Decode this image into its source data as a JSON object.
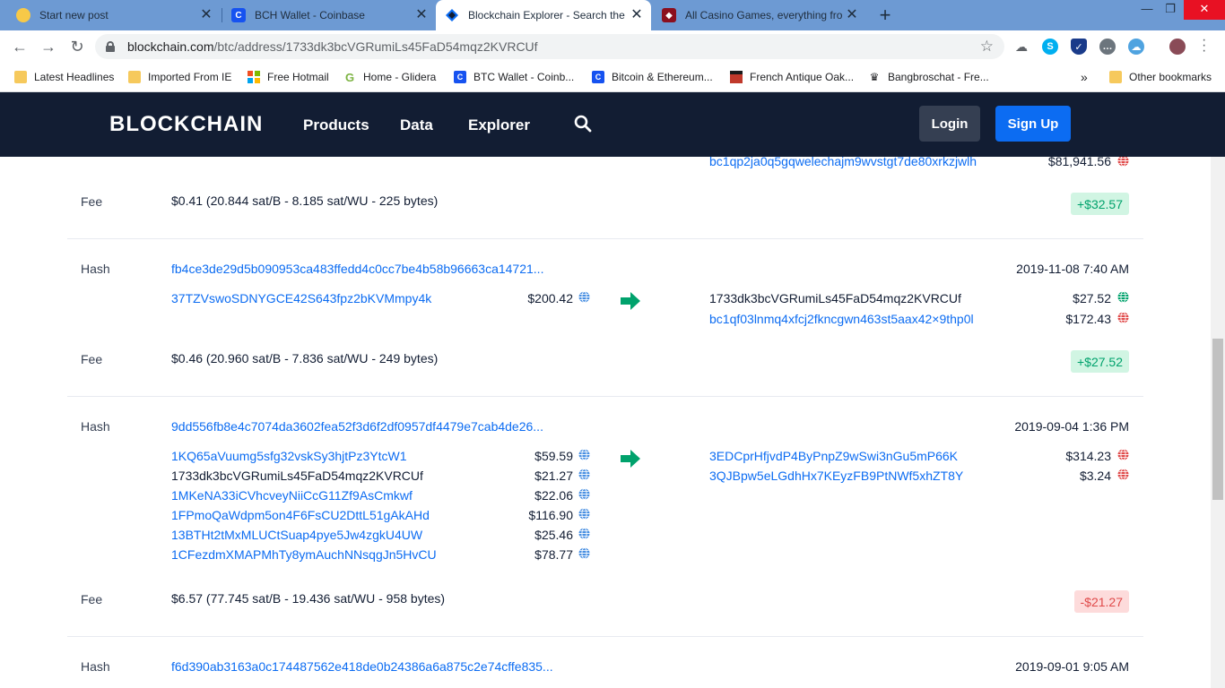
{
  "browser": {
    "tabs": [
      {
        "title": "Start new post"
      },
      {
        "title": "BCH Wallet - Coinbase"
      },
      {
        "title": "Blockchain Explorer - Search the"
      },
      {
        "title": "All Casino Games, everything fro"
      }
    ],
    "url_host": "blockchain.com",
    "url_path": "/btc/address/1733dk3bcVGRumiLs45FaD54mqz2KVRCUf",
    "bookmarks": [
      "Latest Headlines",
      "Imported From IE",
      "Free Hotmail",
      "Home - Glidera",
      "BTC Wallet - Coinb...",
      "Bitcoin & Ethereum...",
      "French Antique Oak...",
      "Bangbroschat - Fre..."
    ],
    "other_bookmarks": "Other bookmarks",
    "overflow": "»"
  },
  "site": {
    "logo": "BLOCKCHAIN",
    "nav": [
      "Products",
      "Data",
      "Explorer"
    ],
    "login": "Login",
    "signup": "Sign Up"
  },
  "labels": {
    "hash": "Hash",
    "fee": "Fee"
  },
  "transactions": [
    {
      "outputs": [
        {
          "address": "bc1qp2ja0q5gqwelechajm9wvstgt7de80xrkzjwlh",
          "amount": "$81,941.56"
        }
      ],
      "fee": "$0.41  (20.844 sat/B - 8.185 sat/WU - 225 bytes)",
      "delta": "+$32.57"
    },
    {
      "hash": "fb4ce3de29d5b090953ca483ffedd4c0cc7be4b58b96663ca14721...",
      "date": "2019-11-08 7:40 AM",
      "inputs": [
        {
          "address": "37TZVswoSDNYGCE42S643fpz2bKVMmpy4k",
          "amount": "$200.42"
        }
      ],
      "outputs": [
        {
          "address": "1733dk3bcVGRumiLs45FaD54mqz2KVRCUf",
          "amount": "$27.52"
        },
        {
          "address": "bc1qf03lnmq4xfcj2fkncgwn463st5aax42×9thp0l",
          "amount": "$172.43"
        }
      ],
      "fee": "$0.46  (20.960 sat/B - 7.836 sat/WU - 249 bytes)",
      "delta": "+$27.52"
    },
    {
      "hash": "9dd556fb8e4c7074da3602fea52f3d6f2df0957df4479e7cab4de26...",
      "date": "2019-09-04 1:36 PM",
      "inputs": [
        {
          "address": "1KQ65aVuumg5sfg32vskSy3hjtPz3YtcW1",
          "amount": "$59.59"
        },
        {
          "address": "1733dk3bcVGRumiLs45FaD54mqz2KVRCUf",
          "amount": "$21.27"
        },
        {
          "address": "1MKeNA33iCVhcveyNiiCcG11Zf9AsCmkwf",
          "amount": "$22.06"
        },
        {
          "address": "1FPmoQaWdpm5on4F6FsCU2DttL51gAkAHd",
          "amount": "$116.90"
        },
        {
          "address": "13BTHt2tMxMLUCtSuap4pye5Jw4zgkU4UW",
          "amount": "$25.46"
        },
        {
          "address": "1CFezdmXMAPMhTy8ymAuchNNsqgJn5HvCU",
          "amount": "$78.77"
        }
      ],
      "outputs": [
        {
          "address": "3EDCprHfjvdP4ByPnpZ9wSwi3nGu5mP66K",
          "amount": "$314.23"
        },
        {
          "address": "3QJBpw5eLGdhHx7KEyzFB9PtNWf5xhZT8Y",
          "amount": "$3.24"
        }
      ],
      "fee": "$6.57  (77.745 sat/B - 19.436 sat/WU - 958 bytes)",
      "delta": "-$21.27"
    },
    {
      "hash": "f6d390ab3163a0c174487562e418de0b24386a6a875c2e74cffe835...",
      "date": "2019-09-01 9:05 AM"
    }
  ],
  "colors": {
    "spent": "#e04a4a",
    "unspent": "#00a26c",
    "link": "#0c6cf2",
    "globe": "#4a90e2"
  },
  "icons": [
    "globe-icon",
    "arrow-right-icon",
    "search-icon",
    "star-icon",
    "lock-icon"
  ]
}
